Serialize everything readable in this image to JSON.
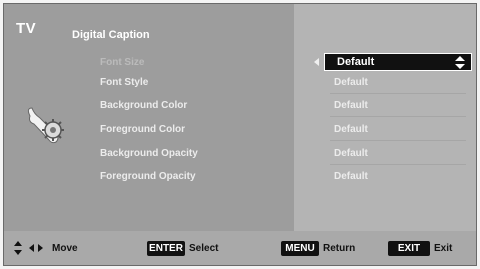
{
  "header": {
    "source": "TV",
    "title": "Digital Caption"
  },
  "settings": [
    {
      "label": "Font Size",
      "value": "Default"
    },
    {
      "label": "Font Style",
      "value": "Default"
    },
    {
      "label": "Background Color",
      "value": "Default"
    },
    {
      "label": "Foreground Color",
      "value": "Default"
    },
    {
      "label": "Background Opacity",
      "value": "Default"
    },
    {
      "label": "Foreground Opacity",
      "value": "Default"
    }
  ],
  "selected_index": 0,
  "footer": {
    "move_label": "Move",
    "enter_key": "ENTER",
    "select_label": "Select",
    "menu_key": "MENU",
    "return_label": "Return",
    "exit_key": "EXIT",
    "exit_label": "Exit"
  },
  "icons": [
    "settings-icon",
    "left-arrow-icon",
    "up-down-arrow-icon",
    "navigation-arrows-icon"
  ],
  "colors": {
    "background": "#8d8d8d",
    "highlight": "#111111",
    "text": "#ffffff"
  }
}
